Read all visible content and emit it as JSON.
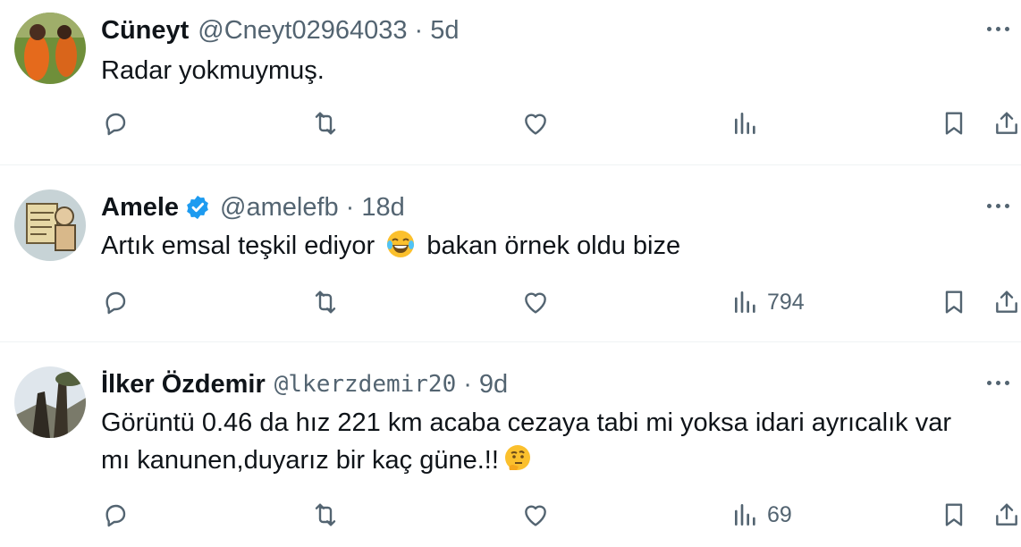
{
  "tweets": [
    {
      "name": "Cüneyt",
      "handle": "@Cneyt02964033",
      "dot": "·",
      "time": "5d",
      "text": "Radar yokmuymuş.",
      "views": ""
    },
    {
      "name": "Amele",
      "handle": "@amelefb",
      "dot": "·",
      "time": "18d",
      "text_before": "Artık emsal teşkil ediyor",
      "emoji": "face-with-tears-of-joy",
      "text_after": "bakan örnek oldu bize",
      "verified": true,
      "views": "794"
    },
    {
      "name": "İlker Özdemir",
      "handle": "@lkerzdemir20",
      "dot": "·",
      "time": "9d",
      "line1": "Görüntü 0.46 da hız 221 km acaba cezaya tabi mi yoksa idari ayrıcalık var",
      "line2": "mı kanunen,duyarız bir kaç güne.!!",
      "emoji": "thinking-face",
      "views": "69"
    }
  ],
  "colors": {
    "text": "#0f1419",
    "secondary": "#536471",
    "verified": "#1d9bf0",
    "divider": "#eff3f4"
  },
  "icons": [
    "reply-icon",
    "retweet-icon",
    "like-icon",
    "views-icon",
    "bookmark-icon",
    "share-icon",
    "more-icon"
  ]
}
